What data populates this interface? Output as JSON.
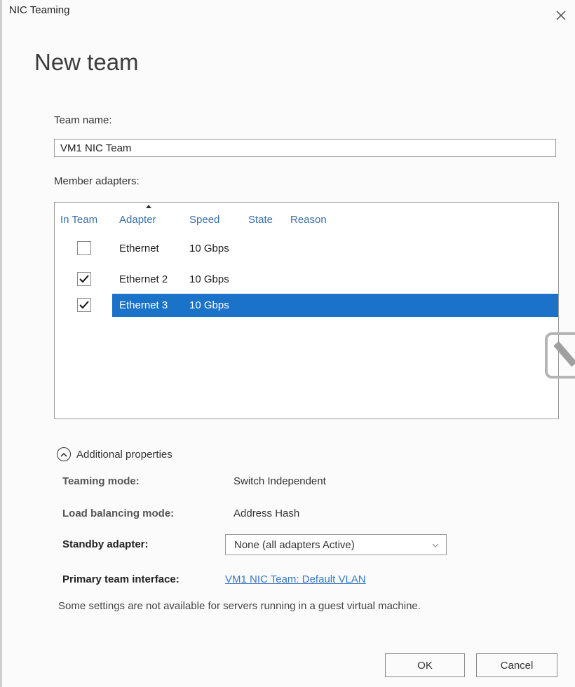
{
  "window": {
    "title": "NIC Teaming"
  },
  "dialog": {
    "heading": "New team"
  },
  "team_name": {
    "label": "Team name:",
    "value": "VM1 NIC Team"
  },
  "members": {
    "label": "Member adapters:",
    "columns": [
      "In Team",
      "Adapter",
      "Speed",
      "State",
      "Reason"
    ],
    "rows": [
      {
        "checked": false,
        "adapter": "Ethernet",
        "speed": "10 Gbps",
        "state": "",
        "reason": "",
        "selected": false
      },
      {
        "checked": true,
        "adapter": "Ethernet 2",
        "speed": "10 Gbps",
        "state": "",
        "reason": "",
        "selected": false
      },
      {
        "checked": true,
        "adapter": "Ethernet 3",
        "speed": "10 Gbps",
        "state": "",
        "reason": "",
        "selected": true
      }
    ]
  },
  "additional": {
    "toggle_label": "Additional properties",
    "teaming_mode": {
      "label": "Teaming mode:",
      "value": "Switch Independent"
    },
    "load_balancing": {
      "label": "Load balancing mode:",
      "value": "Address Hash"
    },
    "standby": {
      "label": "Standby adapter:",
      "value": "None (all adapters Active)"
    },
    "primary": {
      "label": "Primary team interface:",
      "value": "VM1 NIC Team: Default VLAN"
    },
    "note": "Some settings are not available for servers running in a guest virtual machine."
  },
  "buttons": {
    "ok": "OK",
    "cancel": "Cancel"
  },
  "colors": {
    "selection": "#1a73c8",
    "link": "#3a78c2",
    "header": "#3a6fa8"
  }
}
